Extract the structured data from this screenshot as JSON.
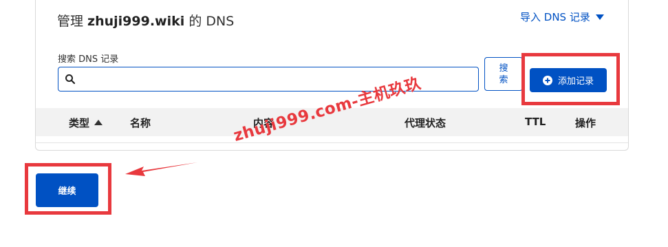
{
  "header": {
    "title_prefix": "管理 ",
    "domain": "zhuji999.wiki",
    "title_suffix": " 的 DNS",
    "import_link": "导入 DNS 记录"
  },
  "search": {
    "label": "搜索 DNS 记录",
    "value": "",
    "placeholder": "",
    "button_label": "搜索"
  },
  "add_record_button": "添加记录",
  "table": {
    "columns": [
      "类型",
      "名称",
      "内容",
      "代理状态",
      "TTL",
      "操作"
    ],
    "sort_column": "类型",
    "sort_direction": "ascending"
  },
  "continue_button": "继续",
  "annotation": {
    "watermark": "zhuji999.com-主机玖玖",
    "highlight_color": "#e8393e"
  },
  "colors": {
    "primary": "#0051c3",
    "table_header_bg": "#f2f2f2"
  },
  "icons": [
    "search-icon",
    "plus-circle-icon",
    "caret-down-icon",
    "sort-ascending-icon",
    "arrow-annotation"
  ]
}
